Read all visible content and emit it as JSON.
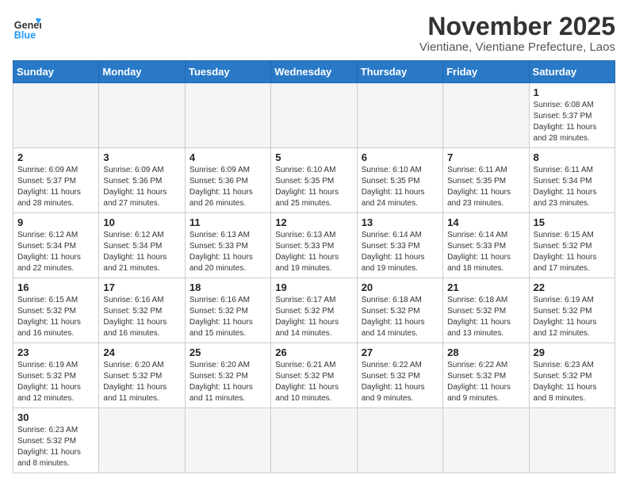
{
  "logo": {
    "text_general": "General",
    "text_blue": "Blue"
  },
  "title": "November 2025",
  "subtitle": "Vientiane, Vientiane Prefecture, Laos",
  "days_of_week": [
    "Sunday",
    "Monday",
    "Tuesday",
    "Wednesday",
    "Thursday",
    "Friday",
    "Saturday"
  ],
  "weeks": [
    [
      {
        "day": "",
        "info": ""
      },
      {
        "day": "",
        "info": ""
      },
      {
        "day": "",
        "info": ""
      },
      {
        "day": "",
        "info": ""
      },
      {
        "day": "",
        "info": ""
      },
      {
        "day": "",
        "info": ""
      },
      {
        "day": "1",
        "info": "Sunrise: 6:08 AM\nSunset: 5:37 PM\nDaylight: 11 hours\nand 28 minutes."
      }
    ],
    [
      {
        "day": "2",
        "info": "Sunrise: 6:09 AM\nSunset: 5:37 PM\nDaylight: 11 hours\nand 28 minutes."
      },
      {
        "day": "3",
        "info": "Sunrise: 6:09 AM\nSunset: 5:36 PM\nDaylight: 11 hours\nand 27 minutes."
      },
      {
        "day": "4",
        "info": "Sunrise: 6:09 AM\nSunset: 5:36 PM\nDaylight: 11 hours\nand 26 minutes."
      },
      {
        "day": "5",
        "info": "Sunrise: 6:10 AM\nSunset: 5:35 PM\nDaylight: 11 hours\nand 25 minutes."
      },
      {
        "day": "6",
        "info": "Sunrise: 6:10 AM\nSunset: 5:35 PM\nDaylight: 11 hours\nand 24 minutes."
      },
      {
        "day": "7",
        "info": "Sunrise: 6:11 AM\nSunset: 5:35 PM\nDaylight: 11 hours\nand 23 minutes."
      },
      {
        "day": "8",
        "info": "Sunrise: 6:11 AM\nSunset: 5:34 PM\nDaylight: 11 hours\nand 23 minutes."
      }
    ],
    [
      {
        "day": "9",
        "info": "Sunrise: 6:12 AM\nSunset: 5:34 PM\nDaylight: 11 hours\nand 22 minutes."
      },
      {
        "day": "10",
        "info": "Sunrise: 6:12 AM\nSunset: 5:34 PM\nDaylight: 11 hours\nand 21 minutes."
      },
      {
        "day": "11",
        "info": "Sunrise: 6:13 AM\nSunset: 5:33 PM\nDaylight: 11 hours\nand 20 minutes."
      },
      {
        "day": "12",
        "info": "Sunrise: 6:13 AM\nSunset: 5:33 PM\nDaylight: 11 hours\nand 19 minutes."
      },
      {
        "day": "13",
        "info": "Sunrise: 6:14 AM\nSunset: 5:33 PM\nDaylight: 11 hours\nand 19 minutes."
      },
      {
        "day": "14",
        "info": "Sunrise: 6:14 AM\nSunset: 5:33 PM\nDaylight: 11 hours\nand 18 minutes."
      },
      {
        "day": "15",
        "info": "Sunrise: 6:15 AM\nSunset: 5:32 PM\nDaylight: 11 hours\nand 17 minutes."
      }
    ],
    [
      {
        "day": "16",
        "info": "Sunrise: 6:15 AM\nSunset: 5:32 PM\nDaylight: 11 hours\nand 16 minutes."
      },
      {
        "day": "17",
        "info": "Sunrise: 6:16 AM\nSunset: 5:32 PM\nDaylight: 11 hours\nand 16 minutes."
      },
      {
        "day": "18",
        "info": "Sunrise: 6:16 AM\nSunset: 5:32 PM\nDaylight: 11 hours\nand 15 minutes."
      },
      {
        "day": "19",
        "info": "Sunrise: 6:17 AM\nSunset: 5:32 PM\nDaylight: 11 hours\nand 14 minutes."
      },
      {
        "day": "20",
        "info": "Sunrise: 6:18 AM\nSunset: 5:32 PM\nDaylight: 11 hours\nand 14 minutes."
      },
      {
        "day": "21",
        "info": "Sunrise: 6:18 AM\nSunset: 5:32 PM\nDaylight: 11 hours\nand 13 minutes."
      },
      {
        "day": "22",
        "info": "Sunrise: 6:19 AM\nSunset: 5:32 PM\nDaylight: 11 hours\nand 12 minutes."
      }
    ],
    [
      {
        "day": "23",
        "info": "Sunrise: 6:19 AM\nSunset: 5:32 PM\nDaylight: 11 hours\nand 12 minutes."
      },
      {
        "day": "24",
        "info": "Sunrise: 6:20 AM\nSunset: 5:32 PM\nDaylight: 11 hours\nand 11 minutes."
      },
      {
        "day": "25",
        "info": "Sunrise: 6:20 AM\nSunset: 5:32 PM\nDaylight: 11 hours\nand 11 minutes."
      },
      {
        "day": "26",
        "info": "Sunrise: 6:21 AM\nSunset: 5:32 PM\nDaylight: 11 hours\nand 10 minutes."
      },
      {
        "day": "27",
        "info": "Sunrise: 6:22 AM\nSunset: 5:32 PM\nDaylight: 11 hours\nand 9 minutes."
      },
      {
        "day": "28",
        "info": "Sunrise: 6:22 AM\nSunset: 5:32 PM\nDaylight: 11 hours\nand 9 minutes."
      },
      {
        "day": "29",
        "info": "Sunrise: 6:23 AM\nSunset: 5:32 PM\nDaylight: 11 hours\nand 8 minutes."
      }
    ],
    [
      {
        "day": "30",
        "info": "Sunrise: 6:23 AM\nSunset: 5:32 PM\nDaylight: 11 hours\nand 8 minutes."
      },
      {
        "day": "",
        "info": ""
      },
      {
        "day": "",
        "info": ""
      },
      {
        "day": "",
        "info": ""
      },
      {
        "day": "",
        "info": ""
      },
      {
        "day": "",
        "info": ""
      },
      {
        "day": "",
        "info": ""
      }
    ]
  ]
}
